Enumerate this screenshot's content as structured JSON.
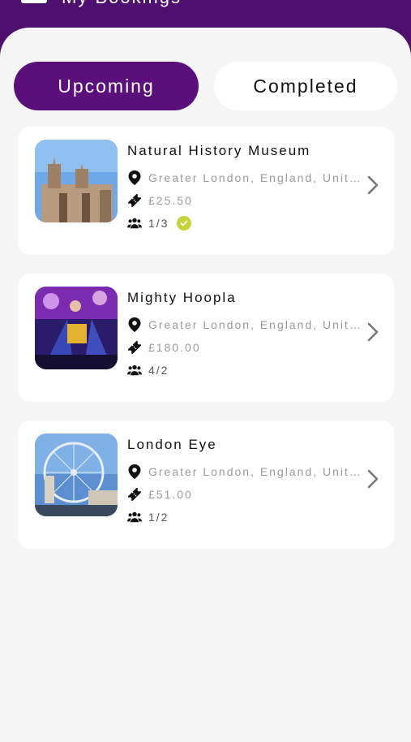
{
  "header": {
    "title": "My Bookings"
  },
  "tabs": [
    {
      "label": "Upcoming",
      "active": true
    },
    {
      "label": "Completed",
      "active": false
    }
  ],
  "bookings": [
    {
      "title": "Natural History Museum",
      "location": "Greater London, England, United Kingdom",
      "price": "£25.50",
      "guests": "1/3",
      "confirmed": true,
      "image": "museum-image"
    },
    {
      "title": "Mighty Hoopla",
      "location": "Greater London, England, United Kingdom",
      "price": "£180.00",
      "guests": "4/2",
      "confirmed": false,
      "image": "festival-image"
    },
    {
      "title": "London Eye",
      "location": "Greater London, England, United Kingdom",
      "price": "£51.00",
      "guests": "1/2",
      "confirmed": false,
      "image": "london-eye-image"
    }
  ],
  "icons": [
    "location-pin-icon",
    "ticket-icon",
    "group-icon",
    "check-icon",
    "chevron-right-icon"
  ],
  "colors": {
    "brand": "#5b0f7a",
    "confirmed": "#c6d33a",
    "muted": "#9a9a9a"
  }
}
